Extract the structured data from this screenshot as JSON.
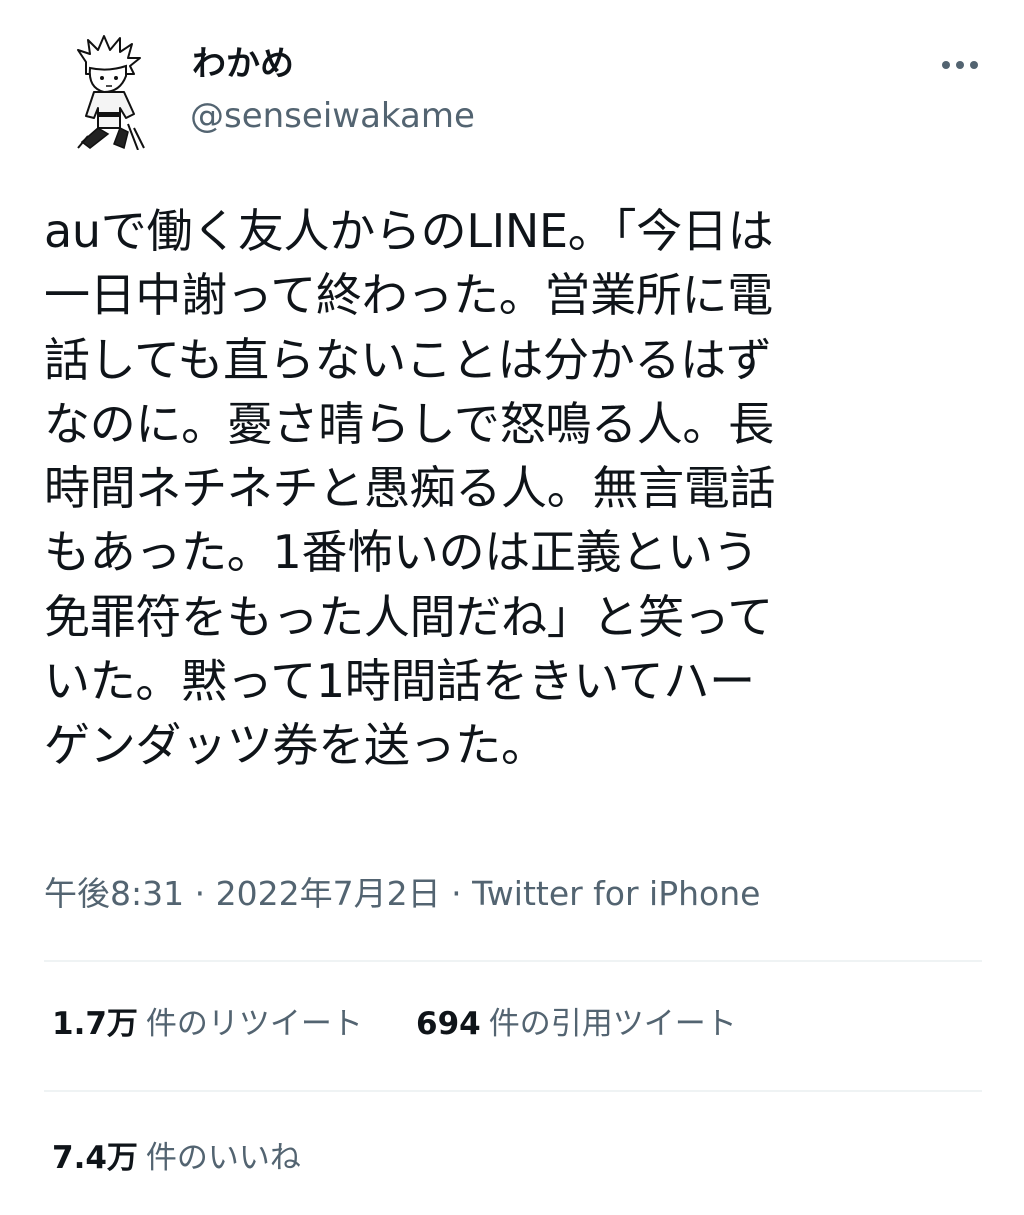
{
  "user": {
    "display_name": "わかめ",
    "handle": "@senseiwakame",
    "avatar_icon": "manga-character-avatar",
    "more_icon": "more-options-icon"
  },
  "tweet": {
    "lines": [
      "auで働く友人からのLINE。「今日は",
      "一日中謝って終わった。営業所に電",
      "話しても直らないことは分かるはず",
      "なのに。憂さ晴らしで怒鳴る人。長",
      "時間ネチネチと愚痴る人。無言電話",
      "もあった。1番怖いのは正義という",
      "免罪符をもった人間だね」と笑って",
      "いた。黙って1時間話をきいてハー",
      "ゲンダッツ券を送った。"
    ]
  },
  "meta": {
    "time": "午後8:31",
    "separator": "·",
    "date": "2022年7月2日",
    "source": "Twitter for iPhone"
  },
  "stats": {
    "retweets_count": "1.7万",
    "retweets_label": "件のリツイート",
    "quotes_count": "694",
    "quotes_label": "件の引用ツイート",
    "likes_count": "7.4万",
    "likes_label": "件のいいね"
  },
  "colors": {
    "text_primary": "#0f1419",
    "text_secondary": "#536471",
    "divider": "#eff3f4"
  }
}
